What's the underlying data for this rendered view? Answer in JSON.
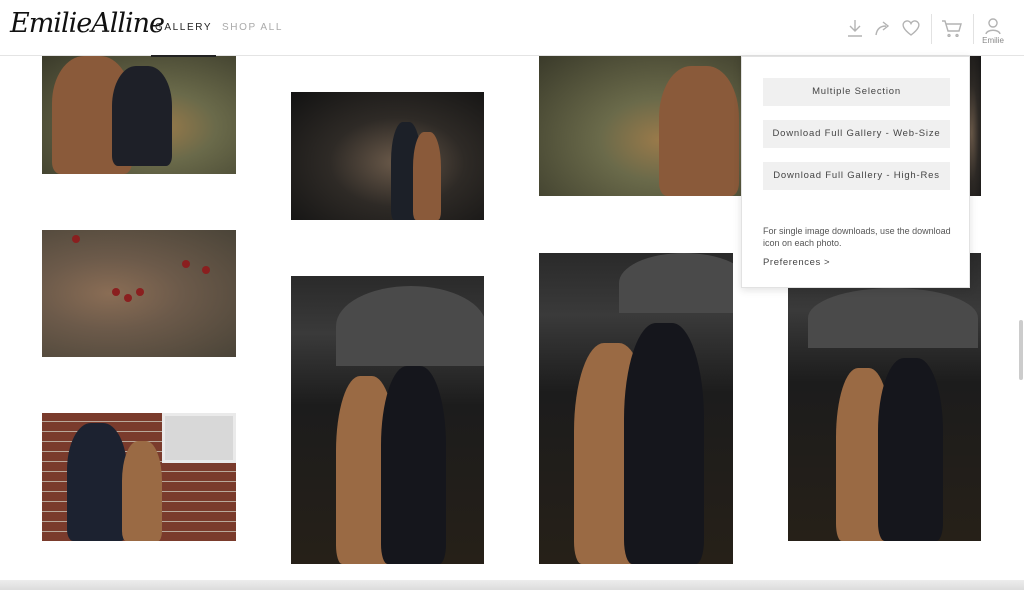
{
  "brand": {
    "logo_text": "EmilieAlline"
  },
  "nav": {
    "gallery": "GALLERY",
    "shop_all": "SHOP ALL"
  },
  "toolbar": {
    "icons": [
      "download-icon",
      "share-icon",
      "heart-icon",
      "cart-icon",
      "user-icon"
    ],
    "user_name": "Emilie"
  },
  "download_menu": {
    "multiple_selection": "Multiple Selection",
    "download_web": "Download Full Gallery - Web-Size",
    "download_high": "Download Full Gallery - High-Res",
    "note": "For single image downloads, use the download icon on each photo.",
    "preferences": "Preferences >"
  },
  "colors": {
    "accent_text": "#222222",
    "muted_text": "#aaaaaa",
    "button_bg": "#f0f0f0"
  }
}
